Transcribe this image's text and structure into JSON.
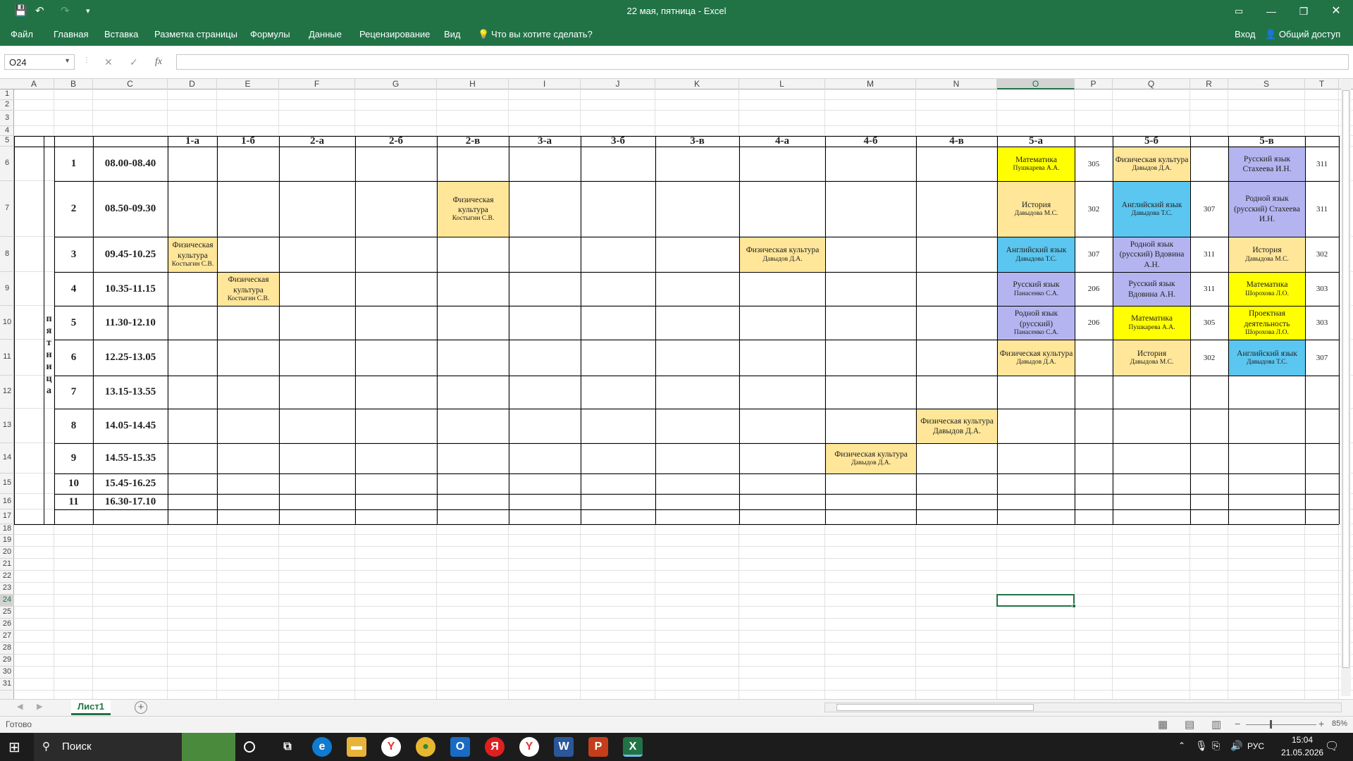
{
  "window": {
    "title": "22 мая, пятница - Excel",
    "signin": "Вход",
    "share": "Общий доступ"
  },
  "ribbon": {
    "tabs": [
      "Файл",
      "Главная",
      "Вставка",
      "Разметка страницы",
      "Формулы",
      "Данные",
      "Рецензирование",
      "Вид"
    ],
    "tell_me": "Что вы хотите сделать?"
  },
  "formula_bar": {
    "name_box": "O24",
    "fx": "fx",
    "value": ""
  },
  "columns": [
    "A",
    "B",
    "C",
    "D",
    "E",
    "F",
    "G",
    "H",
    "I",
    "J",
    "K",
    "L",
    "M",
    "N",
    "O",
    "P",
    "Q",
    "R",
    "S",
    "T"
  ],
  "selected_column": "O",
  "rows": [
    "1",
    "2",
    "3",
    "4",
    "5",
    "6",
    "7",
    "8",
    "9",
    "10",
    "11",
    "12",
    "13",
    "14",
    "15",
    "16",
    "17",
    "18",
    "19",
    "20",
    "21",
    "22",
    "23",
    "24",
    "25",
    "26",
    "27",
    "28",
    "29",
    "30",
    "31"
  ],
  "selected_row": "24",
  "class_headers": {
    "D": "1-а",
    "E": "1-б",
    "F": "2-а",
    "G": "2-б",
    "H": "2-в",
    "I": "3-а",
    "J": "3-б",
    "K": "3-в",
    "L": "4-а",
    "M": "4-б",
    "N": "4-в",
    "O": "5-а",
    "Q": "5-б",
    "S": "5-в"
  },
  "day_label": [
    "п",
    "я",
    "т",
    "н",
    "и",
    "ц",
    "а"
  ],
  "periods": [
    {
      "n": "1",
      "time": "08.00-08.40"
    },
    {
      "n": "2",
      "time": "08.50-09.30"
    },
    {
      "n": "3",
      "time": "09.45-10.25"
    },
    {
      "n": "4",
      "time": "10.35-11.15"
    },
    {
      "n": "5",
      "time": "11.30-12.10"
    },
    {
      "n": "6",
      "time": "12.25-13.05"
    },
    {
      "n": "7",
      "time": "13.15-13.55"
    },
    {
      "n": "8",
      "time": "14.05-14.45"
    },
    {
      "n": "9",
      "time": "14.55-15.35"
    },
    {
      "n": "10",
      "time": "15.45-16.25"
    },
    {
      "n": "11",
      "time": "16.30-17.10"
    }
  ],
  "lessons": [
    {
      "col": "O",
      "period": 1,
      "subject": "Математика",
      "teacher": "Пушкарева А.А.",
      "color": "#ffff00"
    },
    {
      "col": "Q",
      "period": 1,
      "subject": "Физическая культура",
      "teacher": "Давыдов Д.А.",
      "color": "#ffe699"
    },
    {
      "col": "S",
      "period": 1,
      "subject": "Русский язык Стахеева И.Н.",
      "teacher": "",
      "color": "#b4b5f0"
    },
    {
      "col": "H",
      "period": 2,
      "subject": "Физическая культура",
      "teacher": "Костыгин С.В.",
      "color": "#ffe699"
    },
    {
      "col": "O",
      "period": 2,
      "subject": "История",
      "teacher": "Давыдова М.С.",
      "color": "#ffe699"
    },
    {
      "col": "Q",
      "period": 2,
      "subject": "Английский язык",
      "teacher": "Давыдова Т.С.",
      "color": "#5bc6ef"
    },
    {
      "col": "S",
      "period": 2,
      "subject": "Родной язык (русский) Стахеева И.Н.",
      "teacher": "",
      "color": "#b4b5f0"
    },
    {
      "col": "D",
      "period": 3,
      "subject": "Физическая культура",
      "teacher": "Костыгин С.В.",
      "color": "#ffe699"
    },
    {
      "col": "L",
      "period": 3,
      "subject": "Физическая культура",
      "teacher": "Давыдов Д.А.",
      "color": "#ffe699"
    },
    {
      "col": "O",
      "period": 3,
      "subject": "Английский язык",
      "teacher": "Давыдова Т.С.",
      "color": "#5bc6ef"
    },
    {
      "col": "Q",
      "period": 3,
      "subject": "Родной язык (русский) Вдовина А.Н.",
      "teacher": "",
      "color": "#b4b5f0"
    },
    {
      "col": "S",
      "period": 3,
      "subject": "История",
      "teacher": "Давыдова М.С.",
      "color": "#ffe699"
    },
    {
      "col": "E",
      "period": 4,
      "subject": "Физическая культура",
      "teacher": "Костыгин С.В.",
      "color": "#ffe699"
    },
    {
      "col": "O",
      "period": 4,
      "subject": "Русский язык",
      "teacher": "Панасенко С.А.",
      "color": "#b4b5f0"
    },
    {
      "col": "Q",
      "period": 4,
      "subject": "Русский язык Вдовина А.Н.",
      "teacher": "",
      "color": "#b4b5f0"
    },
    {
      "col": "S",
      "period": 4,
      "subject": "Математика",
      "teacher": "Шорохова Л.О.",
      "color": "#ffff00"
    },
    {
      "col": "O",
      "period": 5,
      "subject": "Родной язык (русский)",
      "teacher": "Панасенко С.А.",
      "color": "#b4b5f0"
    },
    {
      "col": "Q",
      "period": 5,
      "subject": "Математика",
      "teacher": "Пушкарева А.А.",
      "color": "#ffff00"
    },
    {
      "col": "S",
      "period": 5,
      "subject": "Проектная деятельность",
      "teacher": "Шорохова Л.О.",
      "color": "#ffff00"
    },
    {
      "col": "O",
      "period": 6,
      "subject": "Физическая культура",
      "teacher": "Давыдов Д.А.",
      "color": "#ffe699"
    },
    {
      "col": "Q",
      "period": 6,
      "subject": "История",
      "teacher": "Давыдова М.С.",
      "color": "#ffe699"
    },
    {
      "col": "S",
      "period": 6,
      "subject": "Английский язык",
      "teacher": "Давыдова Т.С.",
      "color": "#5bc6ef"
    },
    {
      "col": "N",
      "period": 8,
      "subject": "Физическая культура Давыдов Д.А.",
      "teacher": "",
      "color": "#ffe699"
    },
    {
      "col": "M",
      "period": 9,
      "subject": "Физическая культура",
      "teacher": "Давыдов Д.А.",
      "color": "#ffe699"
    }
  ],
  "rooms": [
    {
      "col": "P",
      "period": 1,
      "v": "305"
    },
    {
      "col": "T",
      "period": 1,
      "v": "311"
    },
    {
      "col": "P",
      "period": 2,
      "v": "302"
    },
    {
      "col": "R",
      "period": 2,
      "v": "307"
    },
    {
      "col": "T",
      "period": 2,
      "v": "311"
    },
    {
      "col": "P",
      "period": 3,
      "v": "307"
    },
    {
      "col": "R",
      "period": 3,
      "v": "311"
    },
    {
      "col": "T",
      "period": 3,
      "v": "302"
    },
    {
      "col": "P",
      "period": 4,
      "v": "206"
    },
    {
      "col": "R",
      "period": 4,
      "v": "311"
    },
    {
      "col": "T",
      "period": 4,
      "v": "303"
    },
    {
      "col": "P",
      "period": 5,
      "v": "206"
    },
    {
      "col": "R",
      "period": 5,
      "v": "305"
    },
    {
      "col": "T",
      "period": 5,
      "v": "303"
    },
    {
      "col": "R",
      "period": 6,
      "v": "302"
    },
    {
      "col": "T",
      "period": 6,
      "v": "307"
    }
  ],
  "sheet_tab": "Лист1",
  "status": {
    "ready": "Готово",
    "zoom": "85%"
  },
  "taskbar": {
    "search": "Поиск",
    "lang": "РУС",
    "time": "15:04",
    "date": "21.05.2026"
  }
}
